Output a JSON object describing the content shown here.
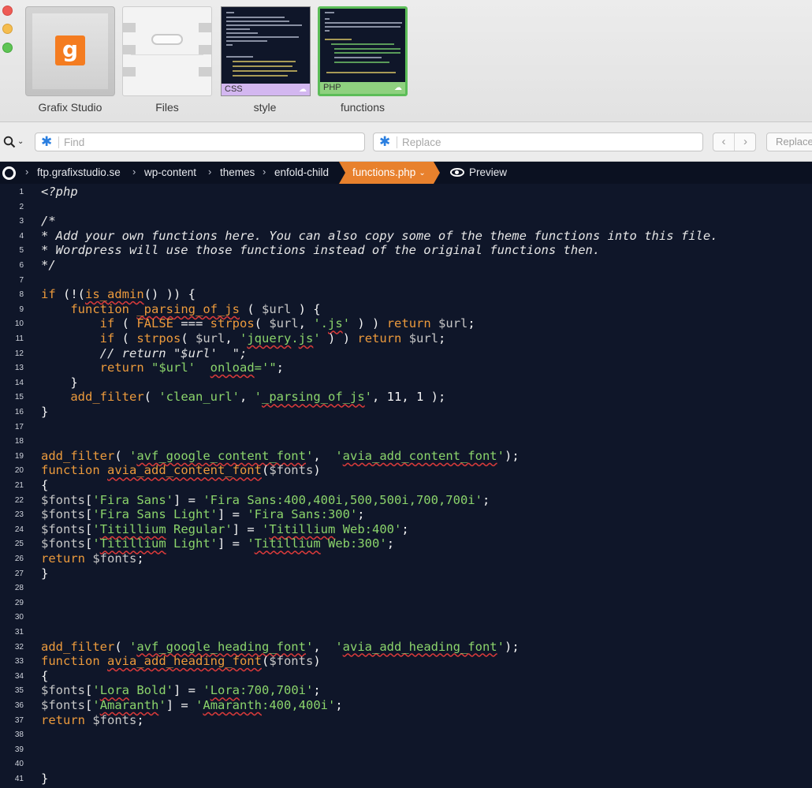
{
  "window": {
    "file_tiles": [
      {
        "name": "Grafix Studio",
        "kind": "site",
        "icon": "grafix-logo",
        "logo_letter": "g"
      },
      {
        "name": "Files",
        "kind": "folder",
        "icon": "file-box-icon"
      },
      {
        "name": "style",
        "kind": "code",
        "tag": "CSS",
        "tag_color": "#d3b7f0"
      },
      {
        "name": "functions",
        "kind": "code",
        "tag": "PHP",
        "tag_color": "#8fd17f",
        "selected": true
      }
    ]
  },
  "search": {
    "find_placeholder": "Find",
    "replace_placeholder": "Replace",
    "prev_icon": "chevron-left-icon",
    "next_icon": "chevron-right-icon",
    "replace_button": "Replace"
  },
  "path": {
    "crumbs": [
      "ftp.grafixstudio.se",
      "wp-content",
      "themes",
      "enfold-child"
    ],
    "active_file": "functions.php",
    "preview_label": "Preview"
  },
  "colors": {
    "editor_bg": "#0f1629",
    "keyword": "#ec9a3c",
    "string": "#8bd46b",
    "active_tab": "#e8812d",
    "spell_error": "#d73a3a"
  },
  "editor": {
    "lines": [
      "<?php",
      "",
      "/*",
      "* Add your own functions here. You can also copy some of the theme functions into this file.",
      "* Wordpress will use those functions instead of the original functions then.",
      "*/",
      "",
      "if (!(is_admin() )) {",
      "    function _parsing_of_js ( $url ) {",
      "        if ( FALSE === strpos( $url, '.js' ) ) return $url;",
      "        if ( strpos( $url, 'jquery.js' ) ) return $url;",
      "        // return \"$url'  \";",
      "        return \"$url'  onload='\";",
      "    }",
      "    add_filter( 'clean_url', '_parsing_of_js', 11, 1 );",
      "}",
      "",
      "",
      "add_filter( 'avf_google_content_font',  'avia_add_content_font');",
      "function avia_add_content_font($fonts)",
      "{",
      "$fonts['Fira Sans'] = 'Fira Sans:400,400i,500,500i,700,700i';",
      "$fonts['Fira Sans Light'] = 'Fira Sans:300';",
      "$fonts['Titillium Regular'] = 'Titillium Web:400';",
      "$fonts['Titillium Light'] = 'Titillium Web:300';",
      "return $fonts;",
      "}",
      "",
      "",
      "",
      "",
      "add_filter( 'avf_google_heading_font',  'avia_add_heading_font');",
      "function avia_add_heading_font($fonts)",
      "{",
      "$fonts['Lora Bold'] = 'Lora:700,700i';",
      "$fonts['Amaranth'] = 'Amaranth:400,400i';",
      "return $fonts;",
      "",
      "",
      "",
      "}"
    ]
  }
}
